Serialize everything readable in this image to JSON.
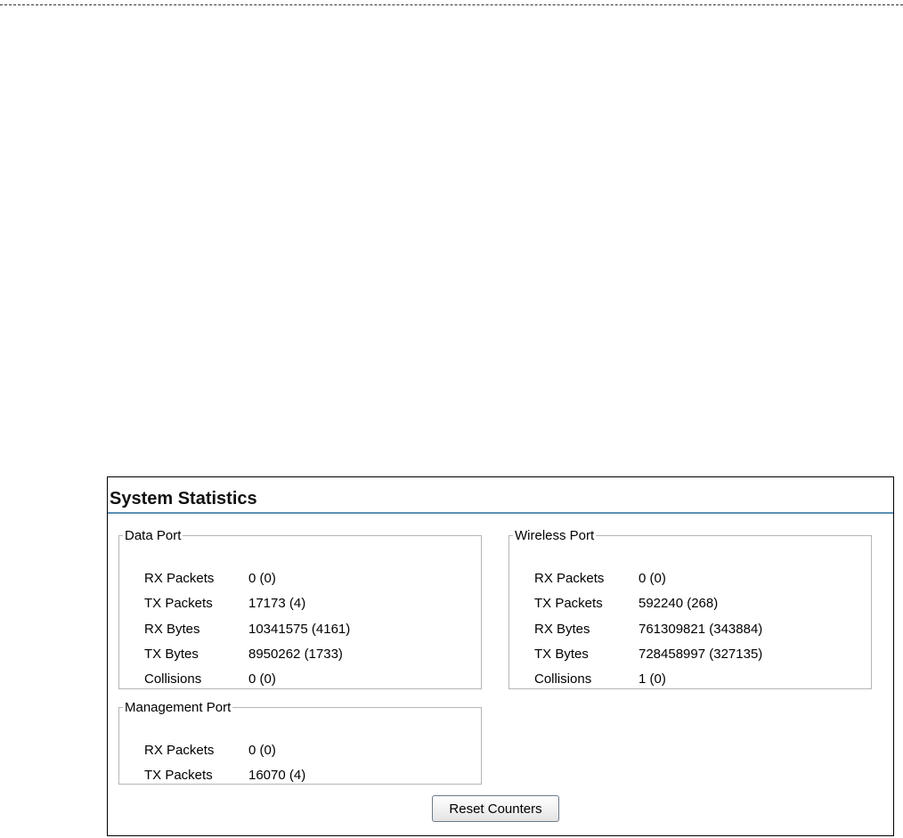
{
  "panel": {
    "title": "System Statistics",
    "reset_button_label": "Reset Counters"
  },
  "data_port": {
    "legend": "Data Port",
    "rows": [
      {
        "label": "RX Packets",
        "value": "0 (0)"
      },
      {
        "label": "TX Packets",
        "value": "17173 (4)"
      },
      {
        "label": "RX Bytes",
        "value": "10341575 (4161)"
      },
      {
        "label": "TX Bytes",
        "value": "8950262 (1733)"
      },
      {
        "label": "Collisions",
        "value": "0 (0)"
      }
    ]
  },
  "wireless_port": {
    "legend": "Wireless Port",
    "rows": [
      {
        "label": "RX Packets",
        "value": "0 (0)"
      },
      {
        "label": "TX Packets",
        "value": "592240 (268)"
      },
      {
        "label": "RX Bytes",
        "value": "761309821 (343884)"
      },
      {
        "label": "TX Bytes",
        "value": "728458997 (327135)"
      },
      {
        "label": "Collisions",
        "value": "1 (0)"
      }
    ]
  },
  "management_port": {
    "legend": "Management Port",
    "rows": [
      {
        "label": "RX Packets",
        "value": "0 (0)"
      },
      {
        "label": "TX Packets",
        "value": "16070 (4)"
      }
    ]
  }
}
